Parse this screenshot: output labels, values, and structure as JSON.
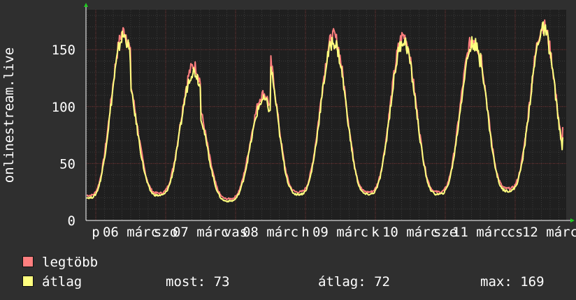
{
  "chart_data": {
    "type": "line",
    "ylabel": "onlinestream.live",
    "ylim": [
      0,
      185
    ],
    "yticks": [
      0,
      50,
      100,
      150
    ],
    "grid": true,
    "legend_placement": "bottom-left",
    "xticks": [
      {
        "day": 0.0,
        "label": "p"
      },
      {
        "day": 0.5,
        "label": "06 márc"
      },
      {
        "day": 1.0,
        "label": "szo"
      },
      {
        "day": 1.5,
        "label": "07 márc"
      },
      {
        "day": 2.0,
        "label": "vas"
      },
      {
        "day": 2.5,
        "label": "08 márc"
      },
      {
        "day": 3.0,
        "label": "h"
      },
      {
        "day": 3.5,
        "label": "09 márc"
      },
      {
        "day": 4.0,
        "label": "k"
      },
      {
        "day": 4.5,
        "label": "10 márc"
      },
      {
        "day": 5.0,
        "label": "sze"
      },
      {
        "day": 5.5,
        "label": "11 márc"
      },
      {
        "day": 6.0,
        "label": "cs"
      },
      {
        "day": 6.5,
        "label": "12 márc"
      }
    ],
    "series": [
      {
        "name": "legtöbb",
        "color": "#ff7f7f",
        "peaks": [
          166,
          136,
          111,
          162,
          162,
          160,
          171
        ],
        "troughs": [
          22,
          24,
          19,
          25,
          25,
          25,
          28
        ],
        "last": 82
      },
      {
        "name": "átlag",
        "color": "#ffff7f",
        "peaks": [
          162,
          131,
          106,
          157,
          158,
          156,
          168
        ],
        "troughs": [
          20,
          22,
          17,
          23,
          23,
          23,
          26
        ],
        "last": 73
      }
    ],
    "summary": {
      "most": 73,
      "atlag": 72,
      "max": 169
    }
  },
  "legend": {
    "max_label": "legtöbb",
    "avg_label": "átlag",
    "stat_now": "most: 73",
    "stat_avg": "átlag: 72",
    "stat_max": "max: 169"
  }
}
